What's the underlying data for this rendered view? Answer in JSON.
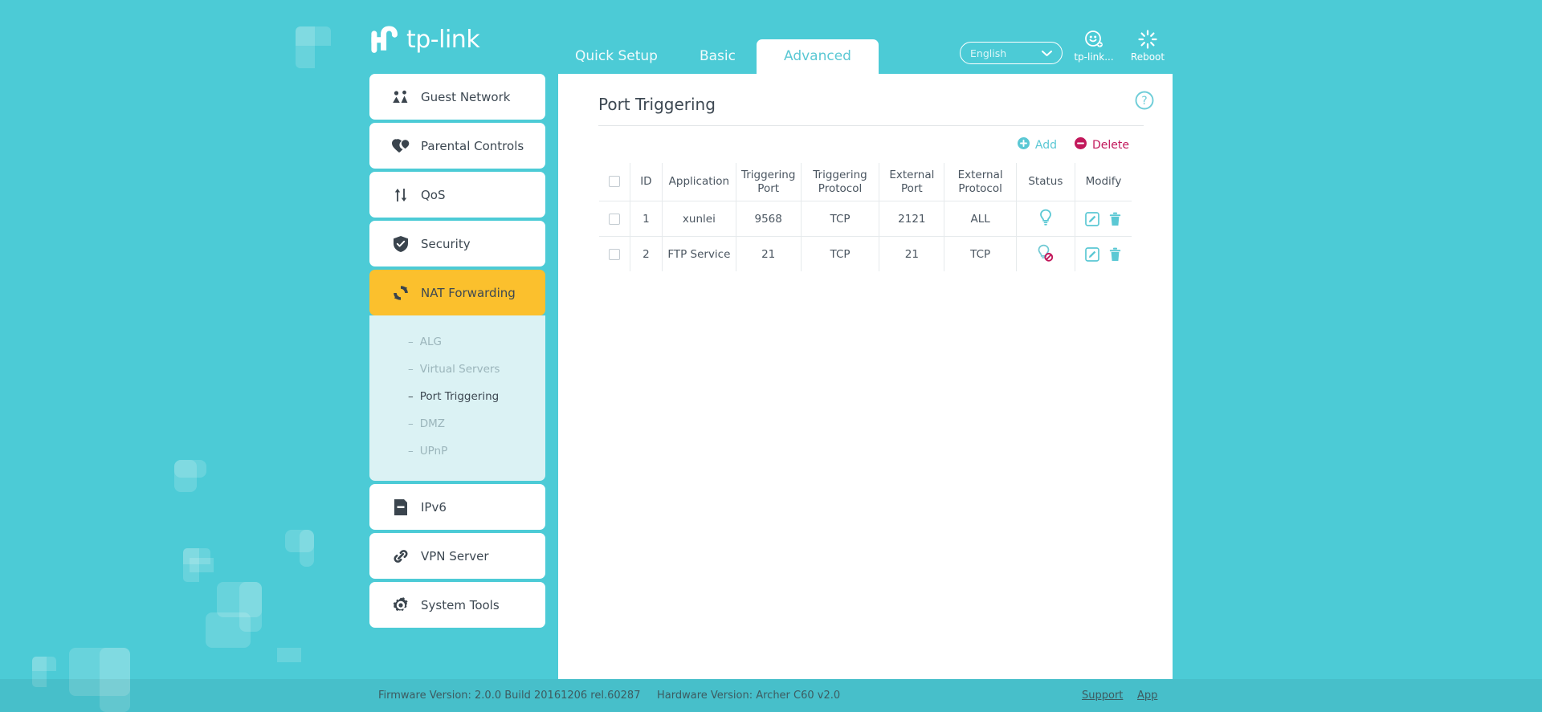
{
  "theme": {
    "brand_teal": "#4ccbd6",
    "accent_yellow": "#fbc02d",
    "accent_pink": "#c2185b",
    "icon_teal": "#5bc8d4",
    "submenu_bg": "#dbf2f4"
  },
  "header": {
    "logo_text": "tp-link",
    "tabs": [
      {
        "label": "Quick Setup",
        "active": false
      },
      {
        "label": "Basic",
        "active": false
      },
      {
        "label": "Advanced",
        "active": true
      }
    ],
    "language": {
      "selected": "English",
      "options": [
        "English"
      ]
    },
    "icons": [
      {
        "name": "tp-link-cloud-icon",
        "label": "tp-link..."
      },
      {
        "name": "reboot-icon",
        "label": "Reboot"
      }
    ]
  },
  "sidebar": {
    "items": [
      {
        "label": "Guest Network",
        "icon": "guests-icon",
        "active": false
      },
      {
        "label": "Parental Controls",
        "icon": "heart-icon",
        "active": false
      },
      {
        "label": "QoS",
        "icon": "updown-arrows-icon",
        "active": false
      },
      {
        "label": "Security",
        "icon": "shield-check-icon",
        "active": false
      },
      {
        "label": "NAT Forwarding",
        "icon": "nat-refresh-icon",
        "active": true
      },
      {
        "label": "IPv6",
        "icon": "document-icon",
        "active": false
      },
      {
        "label": "VPN Server",
        "icon": "chain-link-icon",
        "active": false
      },
      {
        "label": "System Tools",
        "icon": "gear-icon",
        "active": false
      }
    ],
    "submenu": [
      {
        "label": "ALG",
        "active": false
      },
      {
        "label": "Virtual Servers",
        "active": false
      },
      {
        "label": "Port Triggering",
        "active": true
      },
      {
        "label": "DMZ",
        "active": false
      },
      {
        "label": "UPnP",
        "active": false
      }
    ],
    "submenu_dash": "–"
  },
  "main": {
    "page_title": "Port Triggering",
    "help_icon": "question-mark-icon",
    "actions": {
      "add_label": "Add",
      "delete_label": "Delete"
    },
    "table": {
      "headers": [
        "",
        "ID",
        "Application",
        "Triggering\nPort",
        "Triggering\nProtocol",
        "External\nPort",
        "External\nProtocol",
        "Status",
        "Modify"
      ],
      "headers_split": [
        {
          "line1": "",
          "line2": ""
        },
        {
          "line1": "ID",
          "line2": ""
        },
        {
          "line1": "Application",
          "line2": ""
        },
        {
          "line1": "Triggering",
          "line2": "Port"
        },
        {
          "line1": "Triggering",
          "line2": "Protocol"
        },
        {
          "line1": "External",
          "line2": "Port"
        },
        {
          "line1": "External",
          "line2": "Protocol"
        },
        {
          "line1": "Status",
          "line2": ""
        },
        {
          "line1": "Modify",
          "line2": ""
        }
      ],
      "rows": [
        {
          "checked": false,
          "id": "1",
          "application": "xunlei",
          "triggering_port": "9568",
          "triggering_protocol": "TCP",
          "external_port": "2121",
          "external_protocol": "ALL",
          "status": "enabled",
          "status_icon": "bulb-on-icon"
        },
        {
          "checked": false,
          "id": "2",
          "application": "FTP Service",
          "triggering_port": "21",
          "triggering_protocol": "TCP",
          "external_port": "21",
          "external_protocol": "TCP",
          "status": "disabled",
          "status_icon": "bulb-disabled-icon"
        }
      ],
      "modify_icons": [
        "edit-icon",
        "trash-icon"
      ]
    }
  },
  "footer": {
    "firmware": "Firmware Version: 2.0.0 Build 20161206 rel.60287",
    "hardware": "Hardware Version: Archer C60 v2.0",
    "support_label": "Support",
    "app_label": "App"
  }
}
